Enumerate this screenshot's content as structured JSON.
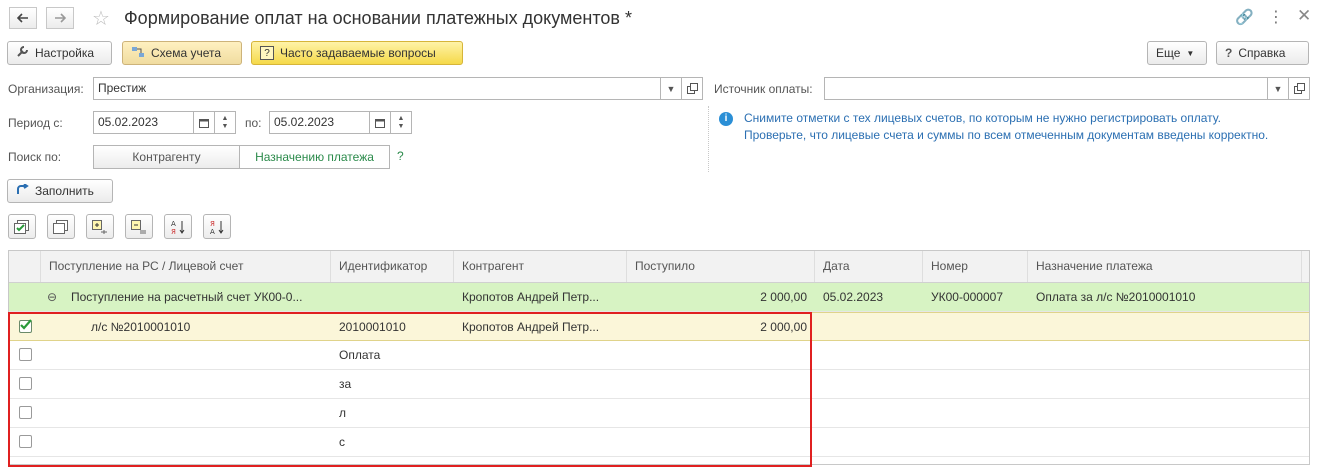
{
  "window": {
    "title": "Формирование оплат на основании платежных документов *"
  },
  "toolbar": {
    "settings_label": "Настройка",
    "scheme_label": "Схема учета",
    "faq_label": "Часто задаваемые вопросы",
    "more_label": "Еще",
    "help_label": "Справка"
  },
  "form": {
    "org_label": "Организация:",
    "org_value": "Престиж",
    "source_label": "Источник оплаты:",
    "source_value": "",
    "period_label": "Период с:",
    "period_from": "05.02.2023",
    "period_to_label": "по:",
    "period_to": "05.02.2023",
    "search_label": "Поиск по:",
    "search_options": [
      "Контрагенту",
      "Назначению платежа"
    ],
    "search_selected": "Назначению платежа",
    "help_q": "?",
    "fill_label": "Заполнить"
  },
  "hint": {
    "line1": "Снимите отметки с тех лицевых счетов, по которым не нужно регистрировать оплату.",
    "line2": "Проверьте, что лицевые счета и суммы по всем отмеченным документам введены корректно."
  },
  "grid": {
    "columns": [
      "Поступление на РС / Лицевой счет",
      "Идентификатор",
      "Контрагент",
      "Поступило",
      "Дата",
      "Номер",
      "Назначение платежа"
    ],
    "group_row": {
      "document": "Поступление на расчетный счет УК00-0...",
      "counterparty": "Кропотов Андрей Петр...",
      "amount": "2 000,00",
      "date": "05.02.2023",
      "number": "УК00-000007",
      "purpose": "Оплата за л/с №2010001010"
    },
    "rows": [
      {
        "checked": true,
        "account": "л/с №2010001010",
        "identifier": "2010001010",
        "counterparty": "Кропотов Андрей Петр...",
        "amount": "2 000,00"
      },
      {
        "checked": false,
        "account": "",
        "identifier": "Оплата",
        "counterparty": "",
        "amount": ""
      },
      {
        "checked": false,
        "account": "",
        "identifier": "за",
        "counterparty": "",
        "amount": ""
      },
      {
        "checked": false,
        "account": "",
        "identifier": "л",
        "counterparty": "",
        "amount": ""
      },
      {
        "checked": false,
        "account": "",
        "identifier": "с",
        "counterparty": "",
        "amount": ""
      }
    ]
  },
  "colors": {
    "group_row_bg": "#d7f3c3",
    "selected_row_bg": "#fbf6d9",
    "hint_text": "#2b6fb2",
    "highlight_border": "#e02020"
  }
}
